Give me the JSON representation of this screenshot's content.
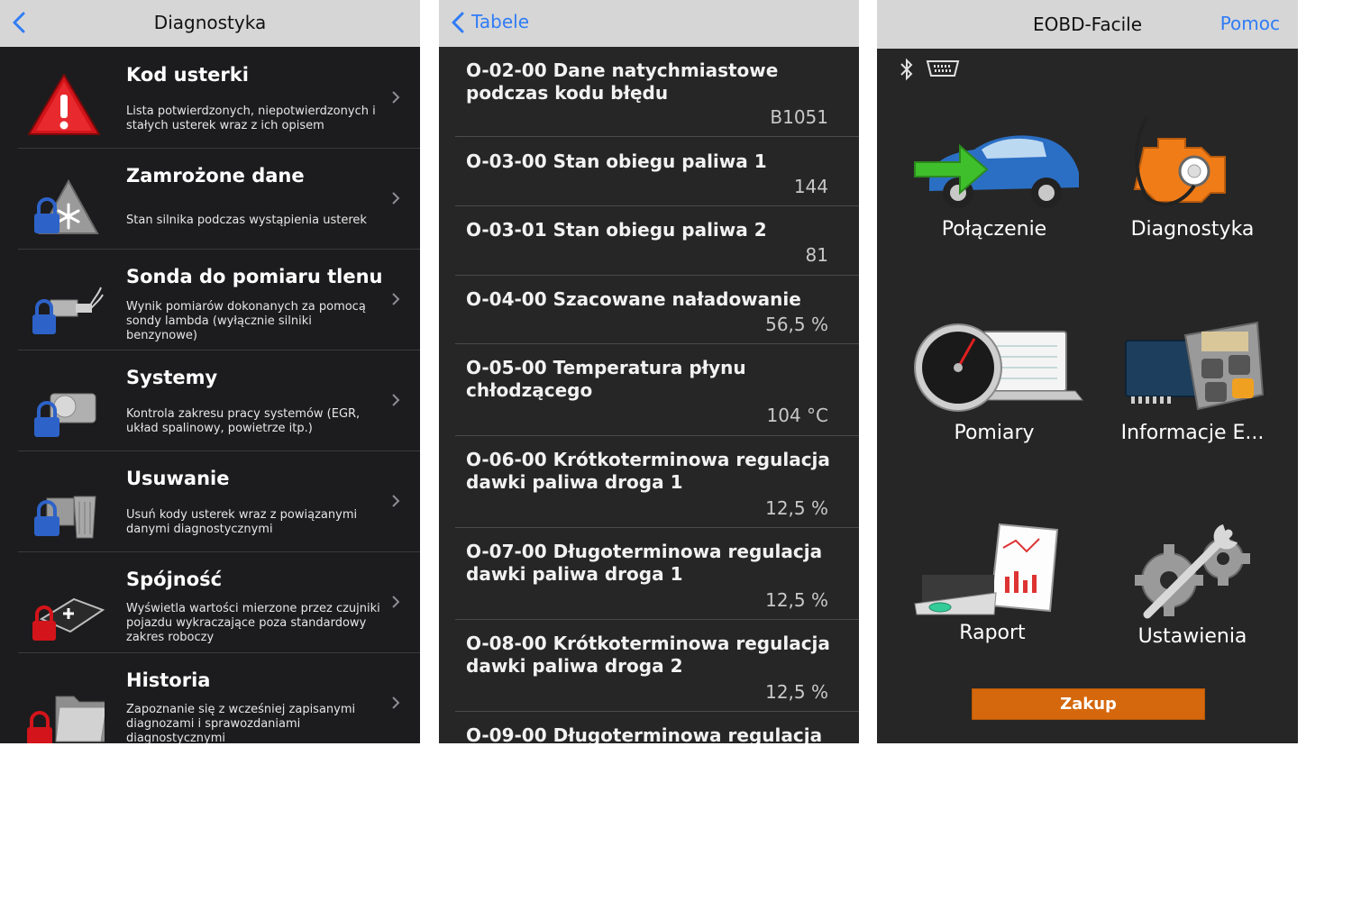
{
  "screen1": {
    "title": "Diagnostyka",
    "items": [
      {
        "title": "Kod usterki",
        "desc": "Lista potwierdzonych, niepotwierdzonych i stałych usterek wraz z ich opisem",
        "icon": "warning-icon"
      },
      {
        "title": "Zamrożone dane",
        "desc": "Stan silnika podczas wystąpienia usterek",
        "icon": "freeze-frame-icon"
      },
      {
        "title": "Sonda do pomiaru tlenu",
        "desc": "Wynik pomiarów dokonanych za pomocą sondy lambda (wyłącznie silniki benzynowe)",
        "icon": "oxygen-sensor-icon"
      },
      {
        "title": "Systemy",
        "desc": "Kontrola zakresu pracy systemów (EGR, układ spalinowy, powietrze itp.)",
        "icon": "systems-icon"
      },
      {
        "title": "Usuwanie",
        "desc": "Usuń kody usterek wraz z powiązanymi danymi diagnostycznymi",
        "icon": "clear-codes-icon"
      },
      {
        "title": "Spójność",
        "desc": "Wyświetla wartości mierzone przez czujniki pojazdu wykraczające poza standardowy zakres roboczy",
        "icon": "consistency-icon"
      },
      {
        "title": "Historia",
        "desc": "Zapoznanie się z wcześniej zapisanymi diagnozami i sprawozdaniami diagnostycznymi",
        "icon": "history-folder-icon"
      }
    ]
  },
  "screen2": {
    "back_label": "Tabele",
    "items": [
      {
        "title": "O-02-00 Dane natychmiastowe podczas kodu błędu",
        "value": "B1051"
      },
      {
        "title": "O-03-00 Stan obiegu paliwa 1",
        "value": "144"
      },
      {
        "title": "O-03-01 Stan obiegu paliwa 2",
        "value": "81"
      },
      {
        "title": "O-04-00 Szacowane naładowanie",
        "value": "56,5 %"
      },
      {
        "title": "O-05-00 Temperatura płynu chłodzącego",
        "value": "104 °C"
      },
      {
        "title": "O-06-00 Krótkoterminowa regulacja dawki paliwa droga 1",
        "value": "12,5 %"
      },
      {
        "title": "O-07-00 Długoterminowa regulacja dawki paliwa droga 1",
        "value": "12,5 %"
      },
      {
        "title": "O-08-00 Krótkoterminowa regulacja dawki paliwa droga 2",
        "value": "12,5 %"
      },
      {
        "title": "O-09-00 Długoterminowa regulacja",
        "value": ""
      }
    ]
  },
  "screen3": {
    "title": "EOBD-Facile",
    "help_label": "Pomoc",
    "tiles": [
      {
        "label": "Połączenie",
        "icon": "car-connection-icon"
      },
      {
        "label": "Diagnostyka",
        "icon": "engine-diagnostic-icon"
      },
      {
        "label": "Pomiary",
        "icon": "gauge-laptop-icon"
      },
      {
        "label": "Informacje E...",
        "icon": "ecu-calculator-icon"
      },
      {
        "label": "Raport",
        "icon": "printer-report-icon"
      },
      {
        "label": "Ustawienia",
        "icon": "gears-wrench-icon"
      }
    ],
    "buy_label": "Zakup",
    "status_icons": [
      "bluetooth-icon",
      "obd-connector-icon"
    ]
  },
  "colors": {
    "nav_bar": "#d6d6d6",
    "link_blue": "#2f7cf6",
    "buy_orange": "#d5670c",
    "list_dark": "#1c1c1e"
  }
}
